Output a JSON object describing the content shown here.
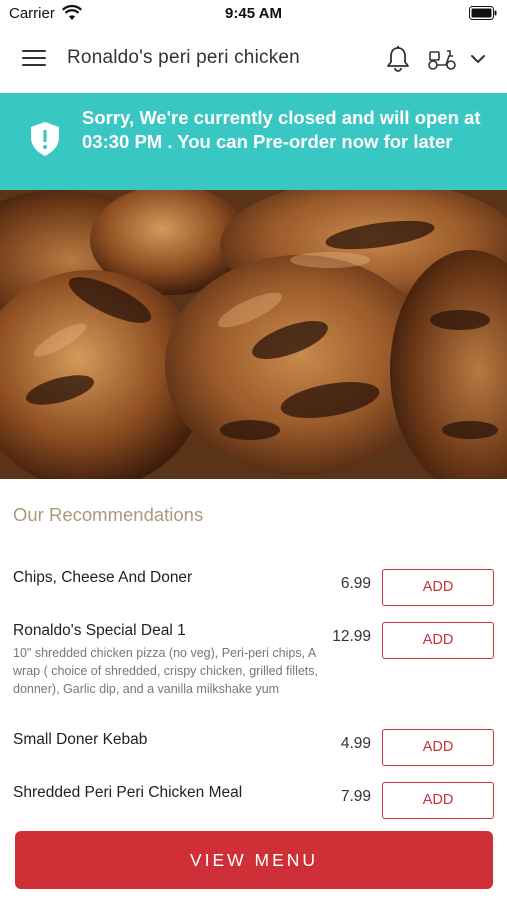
{
  "status_bar": {
    "carrier": "Carrier",
    "time": "9:45 AM"
  },
  "header": {
    "title": "Ronaldo's peri peri chicken",
    "icons": [
      "menu-icon",
      "bell-icon",
      "scooter-icon",
      "chevron-down-icon"
    ]
  },
  "banner": {
    "text": "Sorry, We're currently closed and will open at 03:30 PM . You can Pre-order now for later",
    "background": "#38c7c3",
    "icon": "shield-alert-icon"
  },
  "recommendations": {
    "title": "Our Recommendations",
    "items": [
      {
        "name": "Chips, Cheese And Doner",
        "description": "",
        "price": "6.99",
        "action": "ADD"
      },
      {
        "name": "Ronaldo's Special Deal 1",
        "description": "10\" shredded chicken pizza (no veg), Peri-peri chips,  A wrap ( choice of shredded, crispy chicken, grilled fillets, donner), Garlic dip, and a vanilla milkshake yum",
        "price": "12.99",
        "action": "ADD"
      },
      {
        "name": "Small Doner Kebab",
        "description": "",
        "price": "4.99",
        "action": "ADD"
      },
      {
        "name": "Shredded Peri Peri Chicken Meal",
        "description": "",
        "price": "7.99",
        "action": "ADD"
      }
    ]
  },
  "footer": {
    "view_menu_label": "VIEW MENU"
  },
  "colors": {
    "accent": "#cf2f36",
    "banner": "#38c7c3",
    "section_title": "#a89a7a"
  }
}
